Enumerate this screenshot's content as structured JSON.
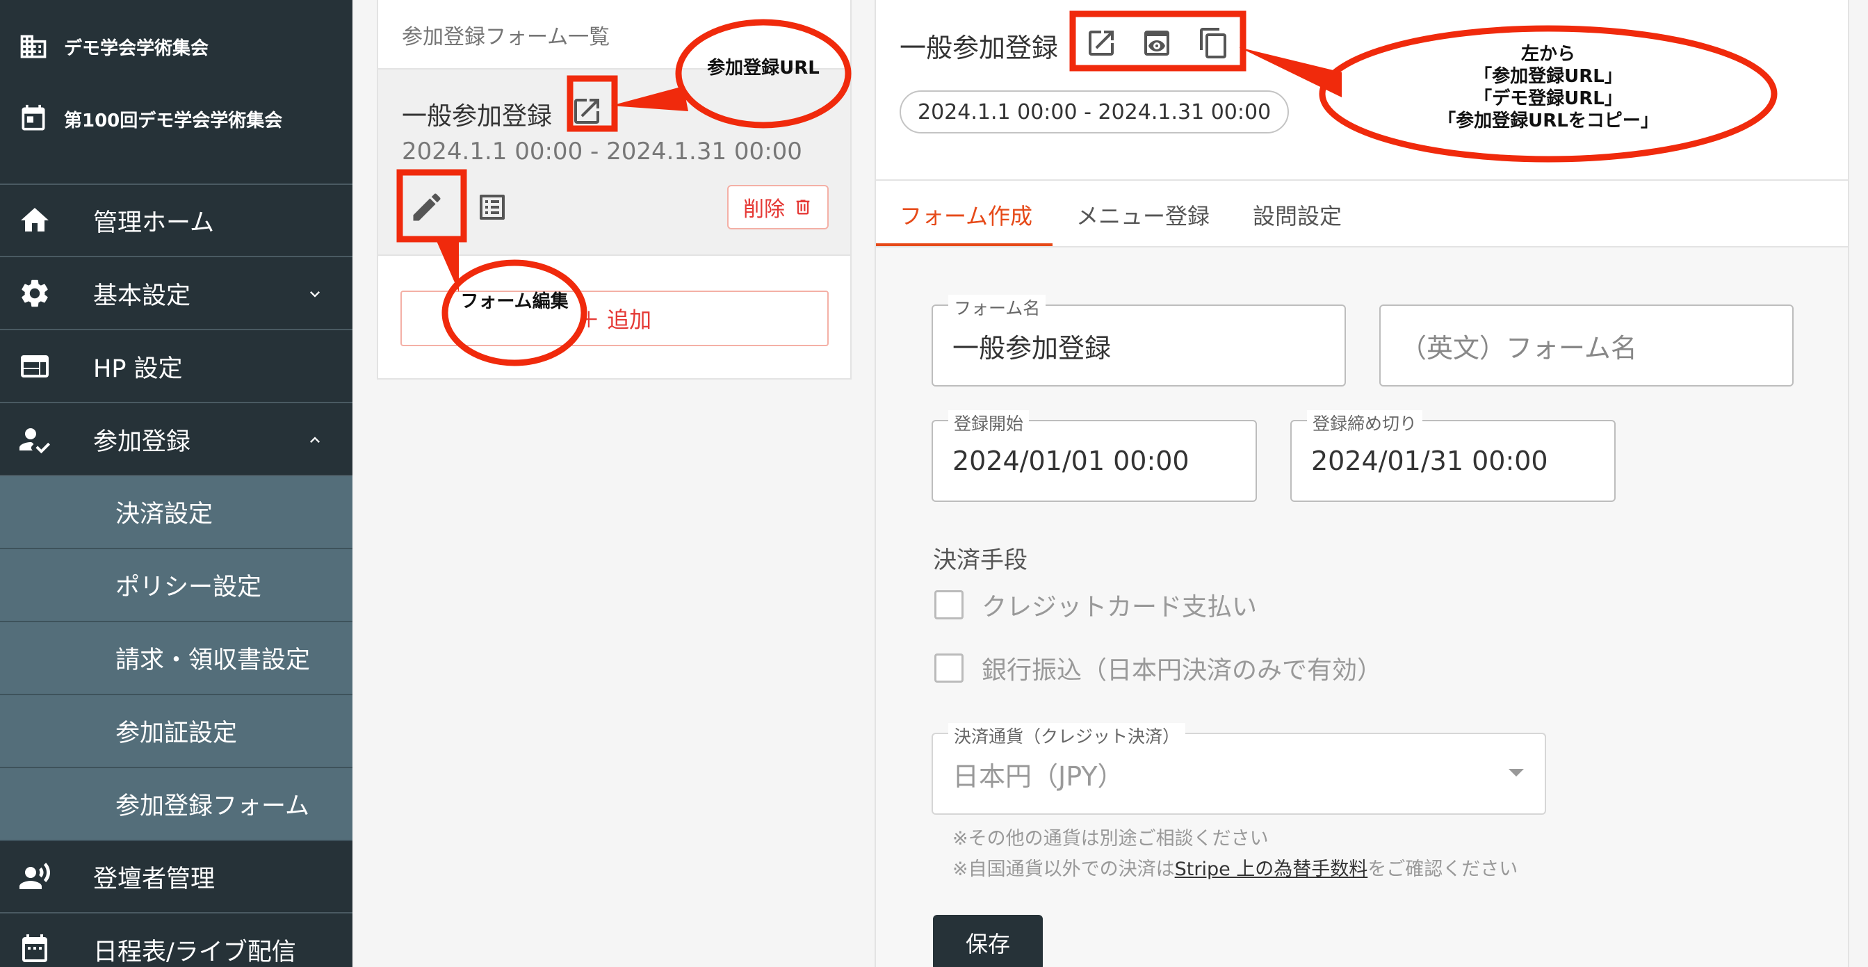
{
  "sidebar": {
    "org_name": "デモ学会学術集会",
    "event_name": "第100回デモ学会学術集会",
    "nav": {
      "home": "管理ホーム",
      "basic": "基本設定",
      "hp": "HP 設定",
      "registration": "参加登録",
      "registrants": "登壇者管理",
      "schedule": "日程表/ライブ配信"
    },
    "sub": [
      "決済設定",
      "ポリシー設定",
      "請求・領収書設定",
      "参加証設定",
      "参加登録フォーム"
    ]
  },
  "form_list": {
    "title": "参加登録フォーム一覧",
    "item": {
      "name": "一般参加登録",
      "date": "2024.1.1 00:00 - 2024.1.31 00:00",
      "delete_label": "削除"
    },
    "add_label": "＋ 追加"
  },
  "panel": {
    "title": "一般参加登録",
    "period": "2024.1.1 00:00 - 2024.1.31 00:00",
    "tabs": [
      "フォーム作成",
      "メニュー登録",
      "設問設定"
    ],
    "fields": {
      "form_name": {
        "label": "フォーム名",
        "value": "一般参加登録"
      },
      "form_name_en": {
        "placeholder": "（英文）フォーム名"
      },
      "start": {
        "label": "登録開始",
        "value": "2024/01/01 00:00"
      },
      "end": {
        "label": "登録締め切り",
        "value": "2024/01/31 00:00"
      }
    },
    "payment": {
      "title": "決済手段",
      "options": [
        "クレジットカード支払い",
        "銀行振込（日本円決済のみで有効）"
      ],
      "currency_label": "決済通貨（クレジット決済）",
      "currency_value": "日本円（JPY）",
      "note1": "※その他の通貨は別途ご相談ください",
      "note2_pre": "※自国通貨以外での決済は",
      "note2_link": "Stripe 上の為替手数料",
      "note2_post": "をご確認ください"
    },
    "save_label": "保存"
  },
  "annotations": {
    "url_label": "参加登録URL",
    "edit_label": "フォーム編集",
    "icons_note": [
      "左から",
      "「参加登録URL」",
      "「デモ登録URL」",
      "「参加登録URLをコピー」"
    ],
    "color": "#f02a0c"
  }
}
